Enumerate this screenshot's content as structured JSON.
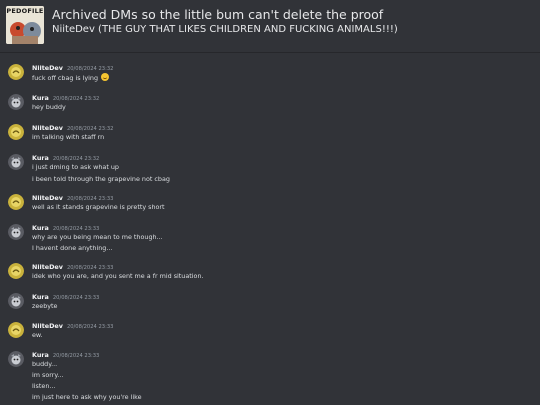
{
  "header": {
    "server_icon_label": "PEDOFILE",
    "title": "Archived DMs so the little bum can't delete the proof",
    "subtitle": "NiiteDev (THE GUY THAT LIKES CHILDREN AND FUCKING ANIMALS!!!)"
  },
  "users": {
    "niitedev": {
      "name": "NiiteDev",
      "avatar": "yellow-coin-avatar"
    },
    "kura": {
      "name": "Kura",
      "avatar": "gray-character-avatar"
    }
  },
  "messages": [
    {
      "author": "NiiteDev",
      "time": "20/08/2024 23:32",
      "lines": [
        "fuck off cbag is lying"
      ],
      "emoji": "grinning-face-emoji"
    },
    {
      "author": "Kura",
      "time": "20/08/2024 23:32",
      "lines": [
        "hey buddy"
      ]
    },
    {
      "author": "NiiteDev",
      "time": "20/08/2024 23:32",
      "lines": [
        "im talking with staff rn"
      ]
    },
    {
      "author": "Kura",
      "time": "20/08/2024 23:32",
      "lines": [
        "i just dming to ask what up",
        "i been told through the grapevine not cbag"
      ]
    },
    {
      "author": "NiiteDev",
      "time": "20/08/2024 23:33",
      "lines": [
        "well as it stands grapevine is pretty short"
      ]
    },
    {
      "author": "Kura",
      "time": "20/08/2024 23:33",
      "lines": [
        "why are you being mean to me though...",
        "I havent done anything..."
      ]
    },
    {
      "author": "NiiteDev",
      "time": "20/08/2024 23:33",
      "lines": [
        "idek who you are, and you sent me a fr mid situation."
      ]
    },
    {
      "author": "Kura",
      "time": "20/08/2024 23:33",
      "lines": [
        "zeebyte"
      ]
    },
    {
      "author": "NiiteDev",
      "time": "20/08/2024 23:33",
      "lines": [
        "ew."
      ]
    },
    {
      "author": "Kura",
      "time": "20/08/2024 23:33",
      "lines": [
        "buddy...",
        "im sorry...",
        "listen...",
        "im just here to ask why you're like"
      ]
    }
  ],
  "colors": {
    "background": "#313338",
    "author": "#f2f3f5",
    "timestamp": "#949ba4",
    "text": "#dbdee1"
  }
}
